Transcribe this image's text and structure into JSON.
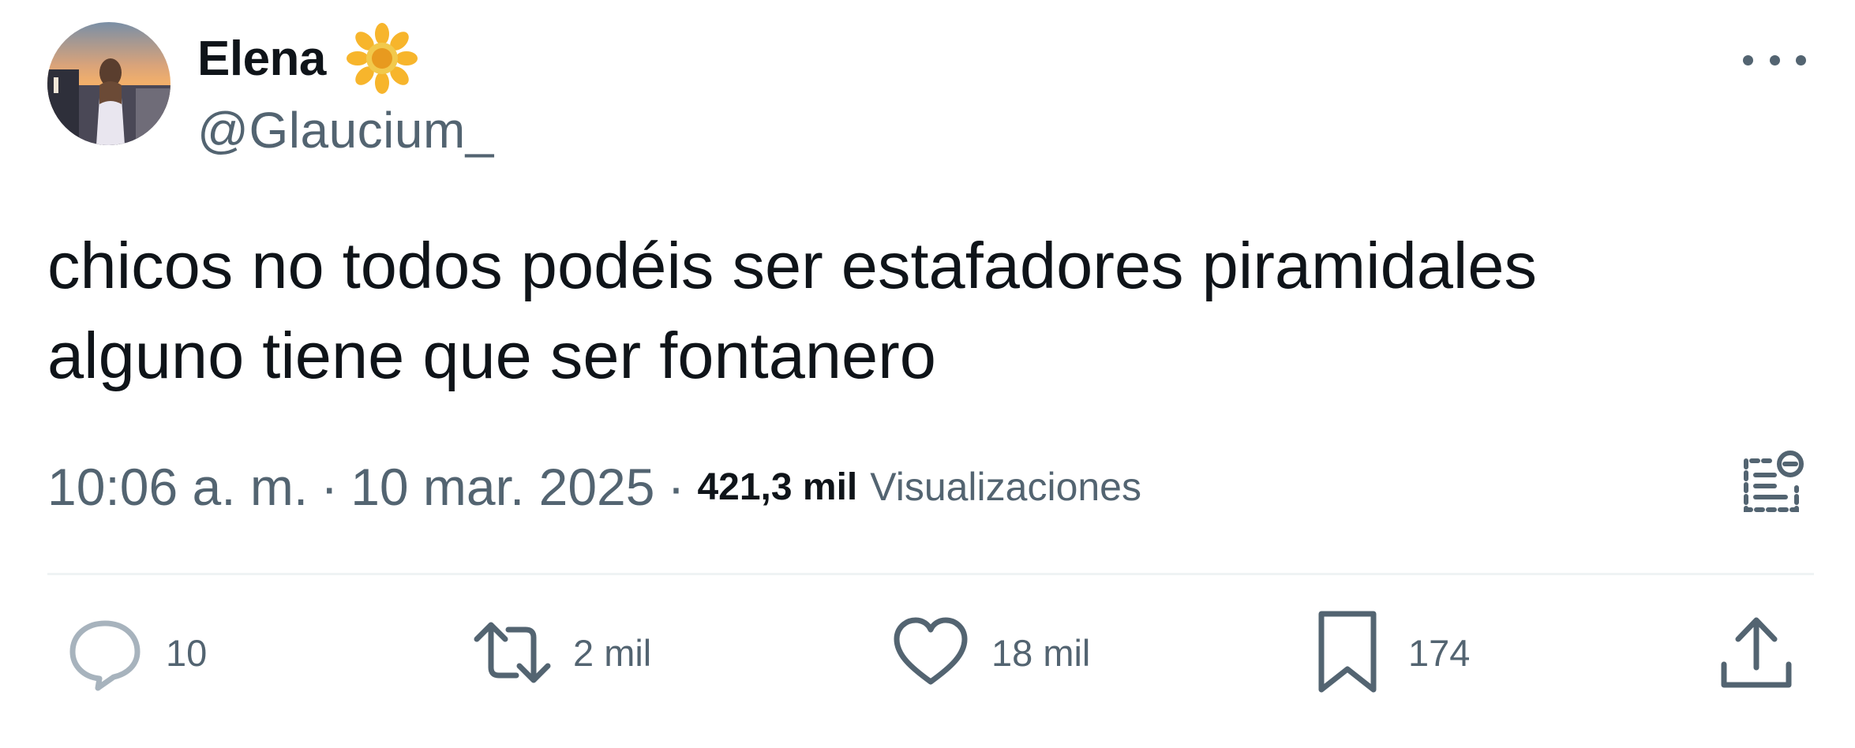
{
  "author": {
    "display_name": "Elena",
    "handle": "@Glaucium_",
    "name_emoji": "sunflower-emoji"
  },
  "tweet": {
    "text": "chicos no todos podéis ser estafadores piramidales\nalguno tiene que ser fontanero"
  },
  "meta": {
    "time": "10:06 a. m.",
    "separator": "·",
    "date": "10 mar. 2025",
    "views_count": "421,3 mil",
    "views_label": "Visualizaciones"
  },
  "actions": {
    "replies": "10",
    "retweets": "2 mil",
    "likes": "18 mil",
    "bookmarks": "174"
  },
  "icons": {
    "more": "more-dots-icon",
    "notes": "community-notes-icon",
    "reply": "reply-bubble-icon",
    "retweet": "retweet-icon",
    "like": "heart-icon",
    "bookmark": "bookmark-icon",
    "share": "share-icon"
  },
  "colors": {
    "text_primary": "#0f1419",
    "text_secondary": "#536471",
    "divider": "#eff3f4",
    "emoji_sun": "#f7b52c"
  }
}
